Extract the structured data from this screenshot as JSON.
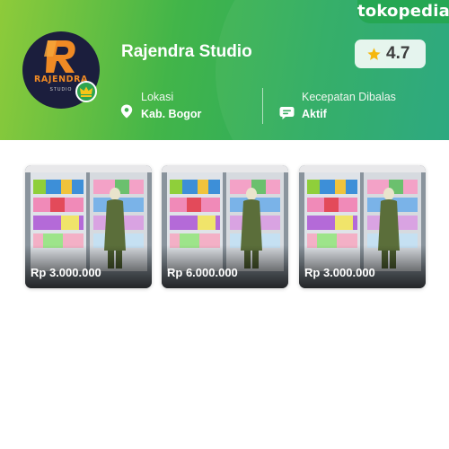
{
  "brand": {
    "name": "tokopedia"
  },
  "shop": {
    "name": "Rajendra Studio",
    "logo_text": "RAJENDRA",
    "logo_subtext": "STUDIO",
    "rating": "4.7",
    "location_label": "Lokasi",
    "location_value": "Kab. Bogor",
    "response_label": "Kecepatan Dibalas",
    "response_value": "Aktif"
  },
  "products": [
    {
      "price": "Rp 3.000.000"
    },
    {
      "price": "Rp 6.000.000"
    },
    {
      "price": "Rp 3.000.000"
    }
  ],
  "colors": {
    "header_green": "#42b549",
    "badge_green": "#1aa34a",
    "logo_orange": "#f08a24",
    "logo_bg": "#1b1e3d",
    "star": "#f5b400"
  },
  "icons": {
    "rating": "star-icon",
    "location": "location-pin-icon",
    "response": "chat-bubble-icon",
    "badge": "crown-icon"
  }
}
